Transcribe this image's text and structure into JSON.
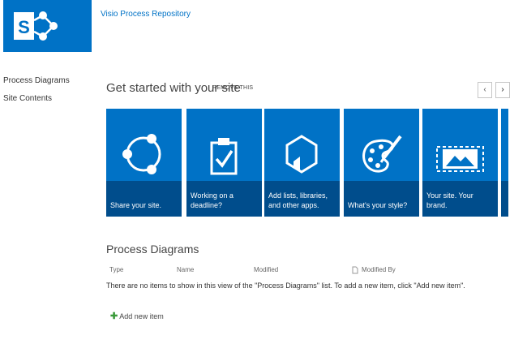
{
  "header": {
    "site_title": "Visio Process Repository",
    "logo_letter": "S",
    "brand_color": "#0072c6"
  },
  "leftnav": {
    "items": [
      {
        "label": "Process Diagrams"
      },
      {
        "label": "Site Contents"
      }
    ]
  },
  "get_started": {
    "title": "Get started with your site",
    "remove_label": "REMOVE THIS",
    "prev_label": "‹",
    "next_label": "›",
    "tiles": [
      {
        "label": "Share your site.",
        "icon": "share-icon"
      },
      {
        "label": "Working on a deadline?",
        "icon": "clipboard-check-icon"
      },
      {
        "label": "Add lists, libraries, and other apps.",
        "icon": "add-apps-icon"
      },
      {
        "label": "What's your style?",
        "icon": "palette-icon"
      },
      {
        "label": "Your site. Your brand.",
        "icon": "brand-image-icon"
      }
    ]
  },
  "list": {
    "title": "Process Diagrams",
    "columns": [
      "Type",
      "Name",
      "Modified",
      "Modified By"
    ],
    "empty_message": "There are no items to show in this view of the \"Process Diagrams\" list. To add a new item, click \"Add new item\".",
    "add_label": "Add new item",
    "add_icon": "plus-icon"
  }
}
